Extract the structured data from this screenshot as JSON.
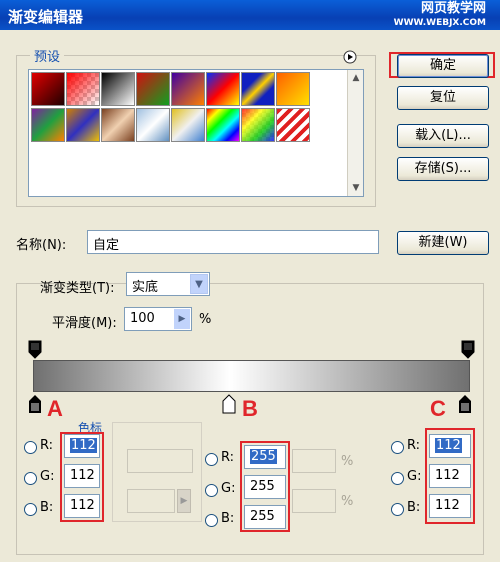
{
  "window": {
    "title": "渐变编辑器",
    "watermark_line1": "网页教学网",
    "watermark_line2": "WWW.WEBJX.COM"
  },
  "presets": {
    "legend": "预设",
    "menu_icon": "circle-arrow-icon"
  },
  "buttons": {
    "ok": "确定",
    "reset": "复位",
    "load": "载入(L)...",
    "save": "存储(S)...",
    "new": "新建(W)"
  },
  "name": {
    "label": "名称(N):",
    "value": "自定"
  },
  "gradient": {
    "type_label": "渐变类型(T):",
    "type_value": "实底",
    "smooth_label": "平滑度(M):",
    "smooth_value": "100",
    "smooth_unit": "%",
    "stops_legend": "色标"
  },
  "markers": {
    "a": "A",
    "b": "B",
    "c": "C"
  },
  "color_a": {
    "r_label": "R:",
    "g_label": "G:",
    "b_label": "B:",
    "r": "112",
    "g": "112",
    "b": "112"
  },
  "color_b": {
    "r_label": "R:",
    "g_label": "G:",
    "b_label": "B:",
    "r": "255",
    "g": "255",
    "b": "255",
    "r_unit": "%",
    "g_unit": "%"
  },
  "color_c": {
    "r_label": "R:",
    "g_label": "G:",
    "b_label": "B:",
    "r": "112",
    "g": "112",
    "b": "112"
  },
  "colors": {
    "accent_red": "#e0262b",
    "title_blue": "#0a52c8"
  }
}
